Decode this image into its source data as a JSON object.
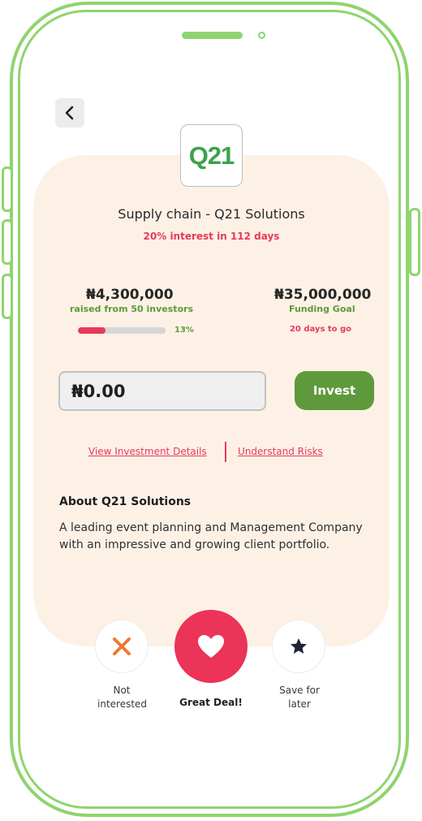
{
  "header": {
    "back_icon": "chevron-left-icon",
    "logo_text": "Q21"
  },
  "offer": {
    "title": "Supply chain - Q21 Solutions",
    "subtitle": "20% interest in 112 days"
  },
  "funding": {
    "raised_amount": "₦4,300,000",
    "raised_label": "raised from 50 investors",
    "progress_percent": 13,
    "progress_label": "13%",
    "goal_amount": "₦35,000,000",
    "goal_label": "Funding Goal",
    "days_left": "20 days to go"
  },
  "invest": {
    "amount_value": "₦0.00",
    "button_label": "Invest"
  },
  "links": {
    "details": "View Investment Details",
    "risks": "Understand Risks"
  },
  "about": {
    "heading": "About Q21 Solutions",
    "body": "A leading event planning and Management Company with an impressive and growing client portfolio."
  },
  "actions": {
    "not_interested": "Not interested",
    "great_deal": "Great Deal!",
    "save_later": "Save for later"
  },
  "colors": {
    "frame": "#8fd46f",
    "accent_red": "#e8395a",
    "brand_green": "#5e9a3c",
    "card_bg": "#fdf1e6",
    "x_orange": "#ec7a33",
    "star_dark": "#1f2533"
  }
}
